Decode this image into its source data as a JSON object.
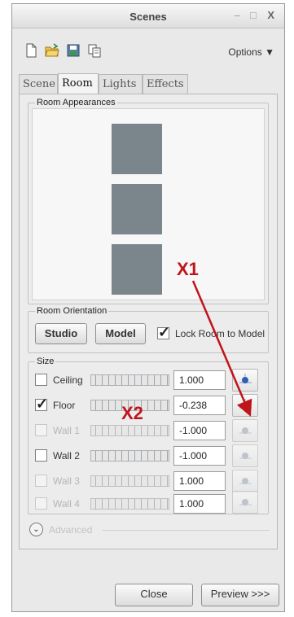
{
  "window": {
    "title": "Scenes"
  },
  "toolbar": {
    "options_label": "Options ▼"
  },
  "tabs": [
    {
      "label": "Scene",
      "active": false
    },
    {
      "label": "Room",
      "active": true
    },
    {
      "label": "Lights",
      "active": false
    },
    {
      "label": "Effects",
      "active": false
    }
  ],
  "room_appearances": {
    "label": "Room Appearances",
    "swatch_color": "#7a858c"
  },
  "room_orientation": {
    "label": "Room Orientation",
    "studio_label": "Studio",
    "model_label": "Model",
    "lock_label": "Lock Room to Model",
    "lock_checked": true
  },
  "size": {
    "label": "Size",
    "rows": [
      {
        "label": "Ceiling",
        "checked": false,
        "enabled": true,
        "value": "1.000"
      },
      {
        "label": "Floor",
        "checked": true,
        "enabled": true,
        "value": "-0.238"
      },
      {
        "label": "Wall 1",
        "checked": false,
        "enabled": false,
        "value": "-1.000"
      },
      {
        "label": "Wall 2",
        "checked": false,
        "enabled": true,
        "value": "-1.000"
      },
      {
        "label": "Wall 3",
        "checked": false,
        "enabled": false,
        "value": "1.000"
      },
      {
        "label": "Wall 4",
        "checked": false,
        "enabled": false,
        "value": "1.000"
      }
    ]
  },
  "advanced": {
    "label": "Advanced"
  },
  "footer": {
    "close_label": "Close",
    "preview_label": "Preview >>>"
  },
  "annotations": {
    "x1": "X1",
    "x2": "X2"
  },
  "colors": {
    "annotation": "#c0141b",
    "window_bg": "#e9e9e9"
  }
}
